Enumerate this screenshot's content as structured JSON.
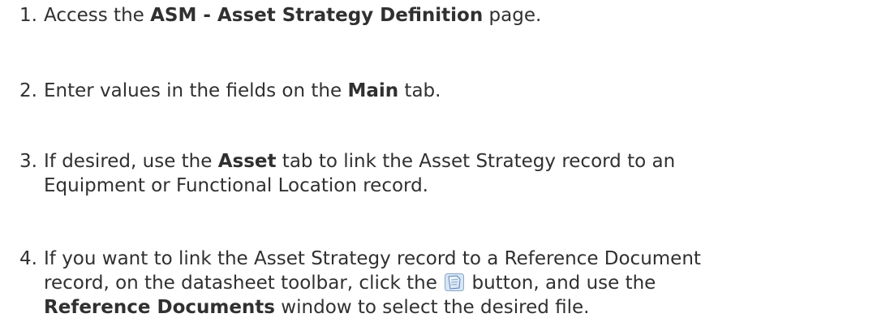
{
  "steps": [
    {
      "number": "1.",
      "pre": "Access the ",
      "bold": "ASM - Asset Strategy Definition",
      "post": " page."
    },
    {
      "number": "2.",
      "pre": "Enter values in the fields on the ",
      "bold": "Main",
      "post": " tab."
    },
    {
      "number": "3.",
      "pre": "If desired, use the ",
      "bold": "Asset",
      "post": " tab to link the Asset Strategy record to an",
      "line2": "Equipment or Functional Location record."
    },
    {
      "number": "4.",
      "line1": "If you want to link the Asset Strategy record to a Reference Document",
      "line2_pre": "record, on the datasheet toolbar, click the ",
      "line2_post": " button, and use the",
      "line3_bold": "Reference Documents",
      "line3_post": " window to select the desired file."
    }
  ],
  "icons": {
    "reference_documents_button": "reference-documents-icon"
  }
}
